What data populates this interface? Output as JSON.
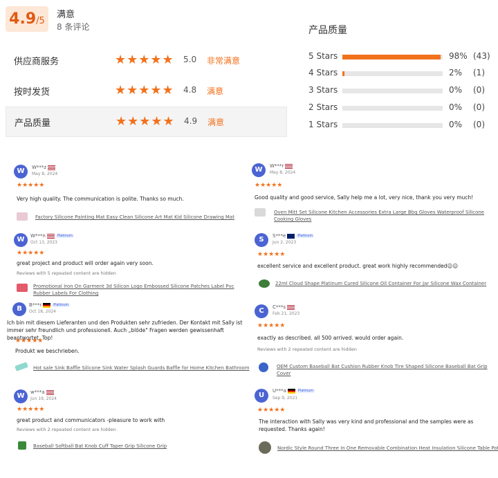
{
  "summary": {
    "score": "4.9",
    "max": "/5",
    "satisfaction": "满意",
    "review_count": "8 条评论"
  },
  "categories": [
    {
      "label": "供应商服务",
      "stars": "★★★★★",
      "score": "5.0",
      "word": "非常满意",
      "selected": false
    },
    {
      "label": "按时发货",
      "stars": "★★★★★",
      "score": "4.8",
      "word": "满意",
      "selected": false
    },
    {
      "label": "产品质量",
      "stars": "★★★★★",
      "score": "4.9",
      "word": "满意",
      "selected": true
    }
  ],
  "breakdown": {
    "title": "产品质量",
    "rows": [
      {
        "label": "5 Stars",
        "percent": "98%",
        "count": "(43)",
        "fill": 0.98
      },
      {
        "label": "4 Stars",
        "percent": "2%",
        "count": "(1)",
        "fill": 0.02
      },
      {
        "label": "3 Stars",
        "percent": "0%",
        "count": "(0)",
        "fill": 0
      },
      {
        "label": "2 Stars",
        "percent": "0%",
        "count": "(0)",
        "fill": 0
      },
      {
        "label": "1 Stars",
        "percent": "0%",
        "count": "(0)",
        "fill": 0
      }
    ]
  },
  "colors": {
    "accent": "#f2711c",
    "avatar": "#4b64d3"
  },
  "reviews": [
    {
      "initial": "W",
      "name": "W***z",
      "flag": "us",
      "platinum": false,
      "date": "May 8, 2024",
      "stars": "★★★★★",
      "text": "Very high quality. The communication is polite. Thanks so much.",
      "note": "",
      "product": "Factory Silicone Painting Mat Easy Clean Silicone Art Mat Kid Silicone Drawing Mat",
      "thumb": "#e9c9d4"
    },
    {
      "initial": "W",
      "name": "W***r",
      "flag": "us",
      "platinum": false,
      "date": "May 8, 2024",
      "stars": "★★★★★",
      "text": "Good quality and good service, Sally help me a lot, very nice, thank you very much!",
      "note": "",
      "product": "Oven Mitt Set Silicone Kitchen Accessories Extra Large Bbq Gloves Waterproof Silicone Cooking Gloves",
      "thumb": "#d9d9d9"
    },
    {
      "initial": "W",
      "name": "W***n",
      "flag": "us",
      "platinum": true,
      "date": "Oct 13, 2023",
      "stars": "★★★★★",
      "text": "great project and product will order again very soon.",
      "note": "Reviews with 5 repeated content are hidden",
      "product": "Promotional Iron On Garment 3d Silicon Logo Embossed Silicone Patches Label Pvc Rubber Labels For Clothing",
      "thumb": "#e35b6a"
    },
    {
      "initial": "S",
      "name": "S***e",
      "flag": "nz",
      "platinum": true,
      "date": "Jun 2, 2023",
      "stars": "★★★★★",
      "text": "excellent service and excellent product. great work highly recommended☺☺",
      "note": "",
      "product": "22ml Cloud Shape Platinum Cured Silicone Oil Container For Jar Silicone Wax Container",
      "thumb": "#3f7d3a"
    },
    {
      "initial": "B",
      "name": "B***r",
      "flag": "de",
      "platinum": true,
      "date": "Oct 18, 2024",
      "stars": "★★★★★",
      "text": "Ich bin mit diesem Lieferanten und den Produkten sehr zufrieden. Der Kontakt mit Sally ist immer sehr freundlich und professionell. Auch „blöde\" Fragen werden gewissenhaft beantwortet. Top!",
      "text2": "Produkt we beschrieben.",
      "note": "",
      "product": "Hot sale Sink Baffle Silicone Sink Water Splash Guards Baffle for Home Kitchen Bathroom",
      "thumb": "#8fd9cf"
    },
    {
      "initial": "C",
      "name": "C***s",
      "flag": "us",
      "platinum": false,
      "date": "Feb 21, 2023",
      "stars": "★★★★★",
      "text": "exactly as described. all 500 arrived. would order again.",
      "note": "Reviews with 2 repeated content are hidden",
      "product": "OEM Custom Baseball Bat Cushion Rubber Knob  Tire Shaped Silicone Baseball Bat Grip Cover",
      "thumb": "#3a64c8"
    },
    {
      "initial": "W",
      "name": "w***a",
      "flag": "us",
      "platinum": false,
      "date": "Jun 19, 2024",
      "stars": "★★★★★",
      "text": "great product and communicators -pleasure to work with",
      "note": "Reviews with 2 repeated content are hidden",
      "product": "Baseball Softball Bat Knob Cuff Taper Grip Silicone Grip",
      "thumb": "#3a8a3a"
    },
    {
      "initial": "U",
      "name": "U***a",
      "flag": "de",
      "platinum": true,
      "date": "Sep 9, 2021",
      "stars": "★★★★★",
      "text": "The interaction with Sally was very kind and professional and the samples were as requested. Thanks again!",
      "note": "",
      "product": "Nordic Style Round Three In One Removable Combination Heat Insulation Silicone Table Pot Cushion",
      "thumb": "#6b6b5a"
    }
  ],
  "labels": {
    "platinum": "Platinum"
  }
}
